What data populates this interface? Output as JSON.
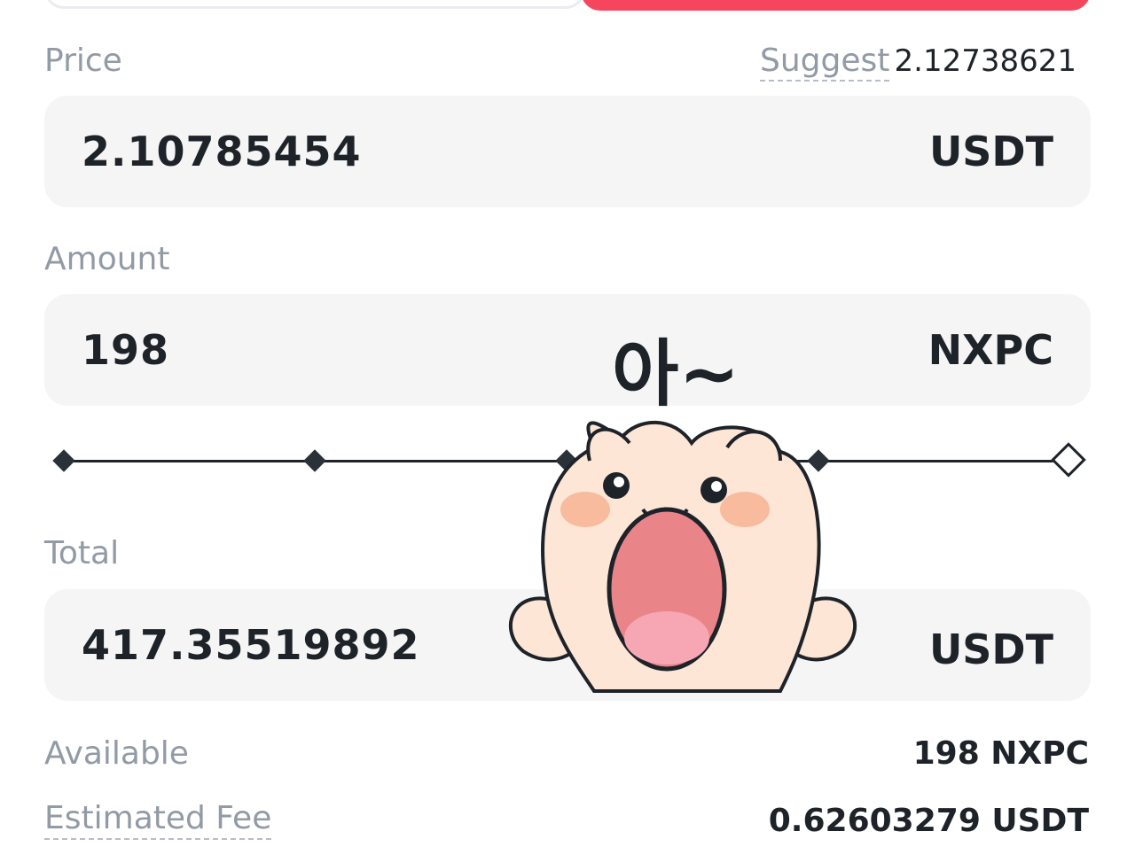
{
  "price": {
    "label": "Price",
    "suggest_label": "Suggest",
    "suggest_value": "2.12738621",
    "value": "2.10785454",
    "unit": "USDT"
  },
  "amount": {
    "label": "Amount",
    "value": "198",
    "unit": "NXPC"
  },
  "slider": {
    "level_fraction": 1.0
  },
  "total": {
    "label": "Total",
    "value": "417.35519892",
    "unit": "USDT"
  },
  "available": {
    "label": "Available",
    "value": "198 NXPC"
  },
  "fee": {
    "label": "Estimated Fee",
    "value": "0.62603279 USDT"
  },
  "sticker": {
    "text": "아~"
  },
  "colors": {
    "sell_accent": "#f6465d",
    "field_bg": "#f5f5f5",
    "label_gray": "#929aa5",
    "text_dark": "#1e2329"
  }
}
